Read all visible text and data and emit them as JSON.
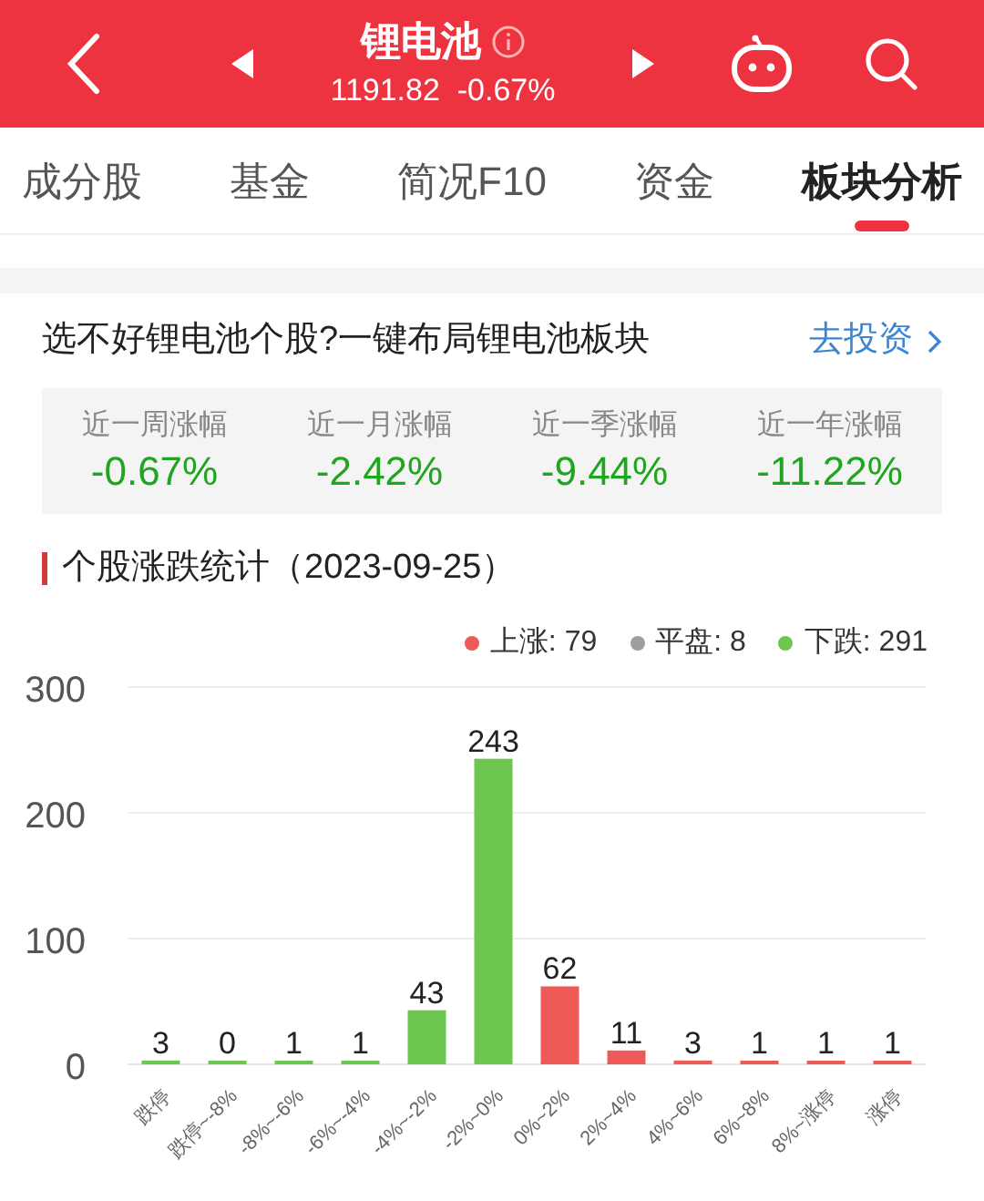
{
  "header": {
    "title": "锂电池",
    "quote": "1191.82  -0.67%"
  },
  "tabs": [
    {
      "label": "成分股",
      "selected": false
    },
    {
      "label": "基金",
      "selected": false
    },
    {
      "label": "简况F10",
      "selected": false
    },
    {
      "label": "资金",
      "selected": false
    },
    {
      "label": "板块分析",
      "selected": true
    }
  ],
  "promo": {
    "text": "选不好锂电池个股?一键布局锂电池板块",
    "link": "去投资"
  },
  "returns": [
    {
      "label": "近一周涨幅",
      "value": "-0.67%"
    },
    {
      "label": "近一月涨幅",
      "value": "-2.42%"
    },
    {
      "label": "近一季涨幅",
      "value": "-9.44%"
    },
    {
      "label": "近一年涨幅",
      "value": "-11.22%"
    }
  ],
  "stats": {
    "title": "个股涨跌统计（2023-09-25）",
    "legend": [
      {
        "label": "上涨: 79",
        "color": "#ee5a58"
      },
      {
        "label": "平盘: 8",
        "color": "#9e9e9e"
      },
      {
        "label": "下跌: 291",
        "color": "#6cc64f"
      }
    ],
    "chart_data": {
      "type": "bar",
      "categories": [
        "跌停",
        "跌停~-8%",
        "-8%~-6%",
        "-6%~-4%",
        "-4%~-2%",
        "-2%~0%",
        "0%~2%",
        "2%~4%",
        "4%~6%",
        "6%~8%",
        "8%~涨停",
        "涨停"
      ],
      "series": [
        {
          "color": "#6cc64f",
          "values": [
            3,
            0,
            1,
            1,
            43,
            243,
            null,
            null,
            null,
            null,
            null,
            null
          ]
        },
        {
          "color": "#ee5a58",
          "values": [
            null,
            null,
            null,
            null,
            null,
            null,
            62,
            11,
            3,
            1,
            1,
            1
          ]
        }
      ],
      "stacked": true,
      "ylim": [
        0,
        300
      ],
      "yticks": [
        0,
        100,
        200,
        300
      ],
      "data_labels": true
    }
  }
}
